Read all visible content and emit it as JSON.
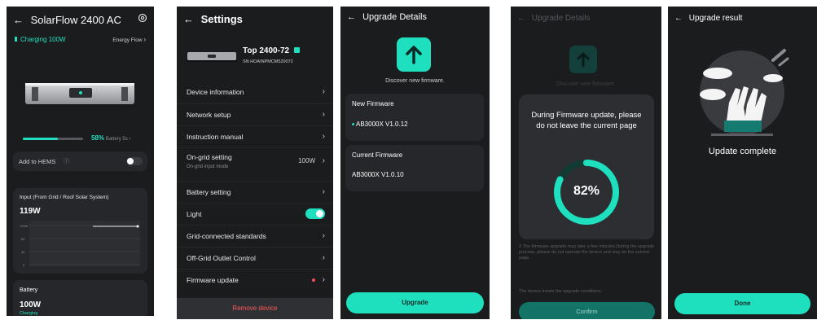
{
  "screen1": {
    "title": "SolarFlow 2400 AC",
    "charging": "Charging 100W",
    "energy_flow": "Energy Flow",
    "battery_percent": "58%",
    "battery_label": "Battery",
    "battery_time": "5s",
    "battery_level": 0.58,
    "add_hems": "Add to HEMS",
    "input_title": "Input (From Grid / Roof Solar System)",
    "input_value": "119W",
    "y_ticks": [
      "120W",
      "80",
      "40",
      "0"
    ],
    "battery_title": "Battery",
    "battery_power": "100W",
    "battery_status": "Charging"
  },
  "screen2": {
    "title": "Settings",
    "device_name": "Top 2400-72",
    "serial": "SN HOAINPMCM520072",
    "items": [
      {
        "label": "Device information"
      },
      {
        "label": "Network setup"
      },
      {
        "label": "Instruction manual"
      },
      {
        "label": "On-grid setting",
        "sub": "On-grid input mode",
        "value": "100W"
      },
      {
        "label": "Battery setting"
      },
      {
        "label": "Light"
      },
      {
        "label": "Grid-connected standards"
      },
      {
        "label": "Off-Grid Outlet Control"
      },
      {
        "label": "Firmware update"
      }
    ],
    "remove": "Remove device"
  },
  "screen3": {
    "title": "Upgrade Details",
    "discover": "Discover new firmware.",
    "new_fw_title": "New Firmware",
    "new_fw_version": "AB3000X  V1.0.12",
    "current_fw_title": "Current Firmware",
    "current_fw_version": "AB3000X  V1.0.10",
    "upgrade_btn": "Upgrade"
  },
  "screen4": {
    "title": "Upgrade Details",
    "discover": "Discover new firmware.",
    "modal_text": "During Firmware update, please do not leave the current page",
    "progress_label": "82%",
    "progress": 0.82,
    "note": "2.The firmware upgrade may take a few minutes.During the upgrade process, please do not operate the device and stay on the current page.",
    "conditions": "The device meets the upgrade conditions.",
    "confirm_btn": "Confirm"
  },
  "screen5": {
    "title": "Upgrade result",
    "complete": "Update complete",
    "done_btn": "Done"
  },
  "colors": {
    "accent": "#1fe0be",
    "bg": "#1b1c1e",
    "card": "#26272a",
    "red_dot": "#ff4d4f",
    "remove": "#ff5a5a"
  }
}
